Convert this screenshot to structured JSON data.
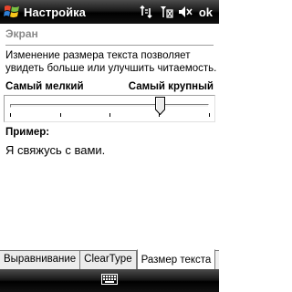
{
  "titlebar": {
    "title": "Настройка",
    "ok_label": "ok",
    "icons": [
      "windows-start-icon",
      "connectivity-icon",
      "signal-icon",
      "volume-icon"
    ]
  },
  "section_title": "Экран",
  "description": "Изменение размера текста позволяет увидеть больше или улучшить читаемость.",
  "slider": {
    "min_label": "Самый мелкий",
    "max_label": "Самый крупный",
    "positions": 5,
    "selected_index": 3
  },
  "example": {
    "label": "Пример:",
    "text": "Я свяжусь с вами."
  },
  "tabs": [
    {
      "label": "Выравнивание",
      "active": false
    },
    {
      "label": "ClearType",
      "active": false
    },
    {
      "label": "Размер текста",
      "active": true
    }
  ],
  "menubar": {
    "icon": "keyboard-icon"
  }
}
